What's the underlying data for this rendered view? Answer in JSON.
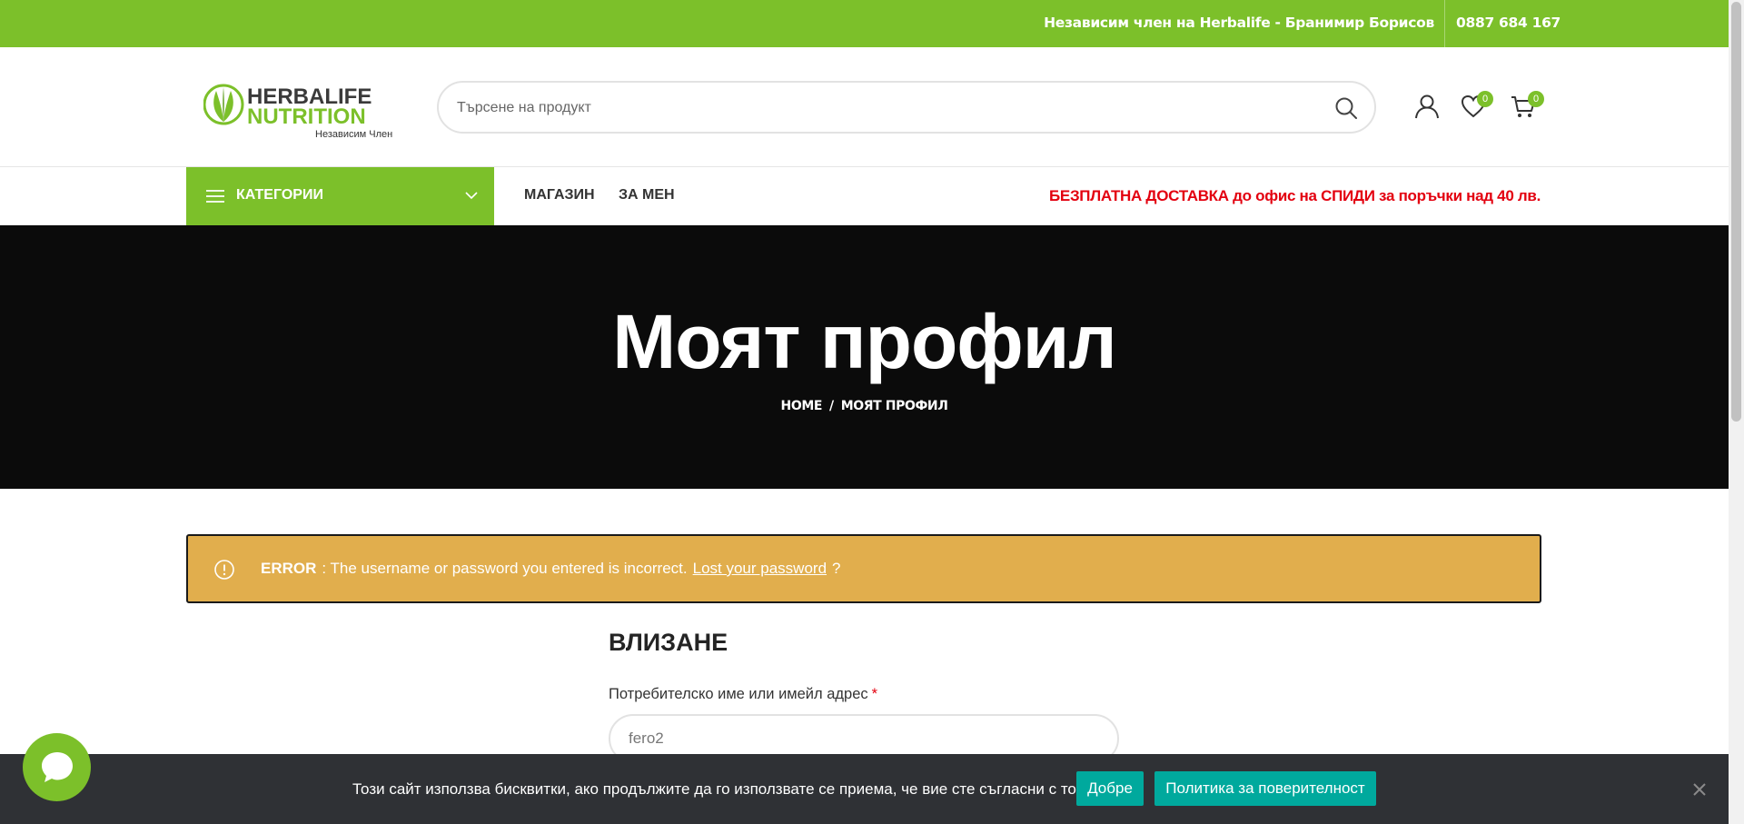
{
  "topbar": {
    "member": "Независим член на Herbalife - Бранимир Борисов",
    "phone": "0887 684 167"
  },
  "logo": {
    "line1": "HERBALIFE",
    "line2": "NUTRITION",
    "tagline": "Независим Член"
  },
  "search": {
    "placeholder": "Търсене на продукт",
    "icon": "search-icon"
  },
  "header_icons": {
    "account": "user-icon",
    "wishlist": "heart-icon",
    "wishlist_count": "0",
    "cart": "cart-icon",
    "cart_count": "0"
  },
  "nav": {
    "categories_label": "КАТЕГОРИИ",
    "links": [
      "МАГАЗИН",
      "ЗА МЕН"
    ],
    "promo": "БЕЗПЛАТНА ДОСТАВКА до офис на СПИДИ за поръчки над 40 лв."
  },
  "hero": {
    "title": "Моят профил",
    "breadcrumb": [
      "HOME",
      "МОЯТ ПРОФИЛ"
    ],
    "separator": "/"
  },
  "alert": {
    "label": "ERROR",
    "message": ": The username or password you entered is incorrect.",
    "link": "Lost your password",
    "suffix": "?",
    "icon": "info-circle-icon"
  },
  "login": {
    "title": "ВЛИЗАНЕ",
    "username_label": "Потребителско име или имейл адрес",
    "required_mark": "*",
    "username_value": "fero2"
  },
  "cookie": {
    "text": "Този сайт използва бисквитки, ако продължите да го използвате се приема, че вие сте съгласни с това.",
    "accept": "Добре",
    "policy": "Политика за поверителност"
  },
  "colors": {
    "brand_green": "#7cc02a",
    "promo_red": "#e3000f",
    "alert_bg": "#e1ae4d",
    "cookie_button": "#00a99d",
    "hero_bg": "#0b0b0b"
  }
}
